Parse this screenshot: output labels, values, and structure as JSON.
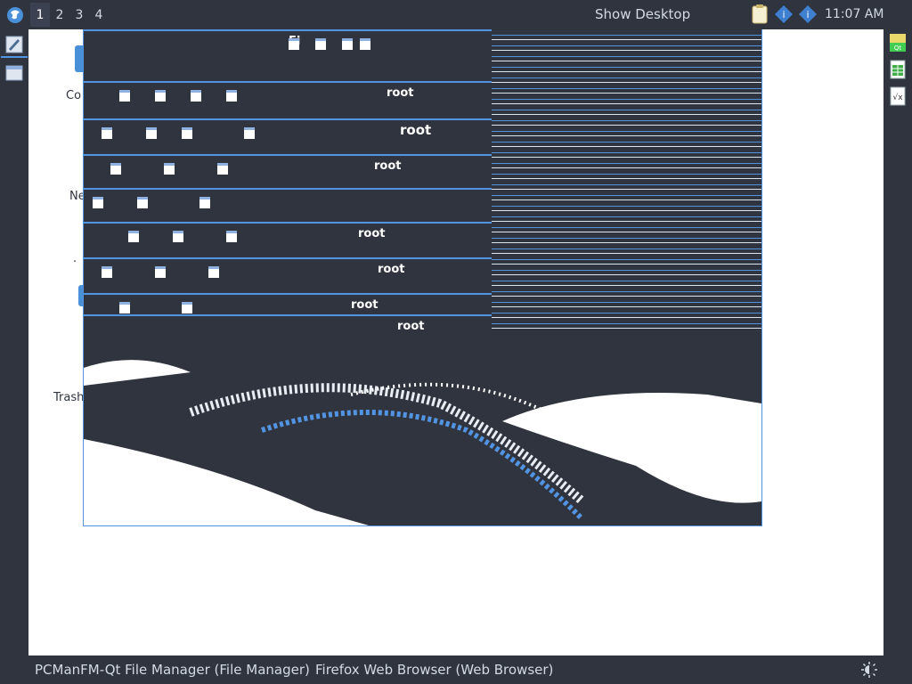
{
  "top_panel": {
    "workspaces": [
      "1",
      "2",
      "3",
      "4"
    ],
    "active_workspace": "1",
    "show_desktop_label": "Show Desktop",
    "clock": "11:07 AM",
    "tray_icons": [
      "clipboard-icon",
      "network-icon",
      "bluetooth-icon"
    ]
  },
  "left_dock": {
    "items": [
      "text-editor-icon",
      "window-icon"
    ]
  },
  "right_dock": {
    "items": [
      "qt-app-icon",
      "spreadsheet-icon",
      "formula-document-icon"
    ]
  },
  "desktop": {
    "icon_labels": [
      "Co",
      "Ne",
      ".",
      "Trash"
    ]
  },
  "glitch_window": {
    "repeated_text": "root",
    "tab_text": "Fi"
  },
  "taskbar": {
    "tasks": [
      "PCManFM-Qt File Manager (File Manager)",
      "Firefox Web Browser (Web Browser)"
    ]
  },
  "colors": {
    "panel_bg": "#2f343f",
    "accent": "#5294e2",
    "desktop_bg": "#ffffff"
  }
}
